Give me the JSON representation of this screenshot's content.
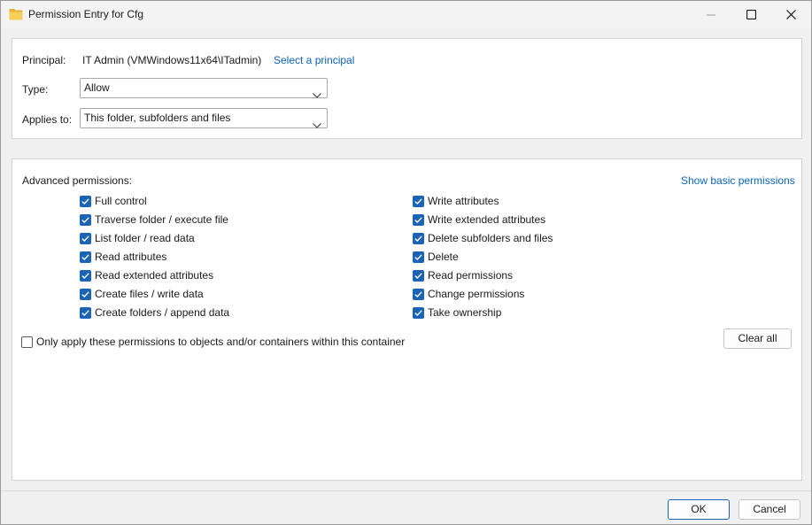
{
  "window": {
    "title": "Permission Entry for Cfg",
    "icons": {
      "app": "folder-icon",
      "minimize": "minimize-icon",
      "maximize": "maximize-icon",
      "close": "close-icon"
    }
  },
  "principal": {
    "label": "Principal:",
    "value": "IT Admin (VMWindows11x64\\ITadmin)",
    "link": "Select a principal"
  },
  "type": {
    "label": "Type:",
    "selected": "Allow"
  },
  "applies_to": {
    "label": "Applies to:",
    "selected": "This folder, subfolders and files"
  },
  "advanced": {
    "heading": "Advanced permissions:",
    "toggle_link": "Show basic permissions",
    "left_column": [
      {
        "label": "Full control",
        "checked": true
      },
      {
        "label": "Traverse folder / execute file",
        "checked": true
      },
      {
        "label": "List folder / read data",
        "checked": true
      },
      {
        "label": "Read attributes",
        "checked": true
      },
      {
        "label": "Read extended attributes",
        "checked": true
      },
      {
        "label": "Create files / write data",
        "checked": true
      },
      {
        "label": "Create folders / append data",
        "checked": true
      }
    ],
    "right_column": [
      {
        "label": "Write attributes",
        "checked": true
      },
      {
        "label": "Write extended attributes",
        "checked": true
      },
      {
        "label": "Delete subfolders and files",
        "checked": true
      },
      {
        "label": "Delete",
        "checked": true
      },
      {
        "label": "Read permissions",
        "checked": true
      },
      {
        "label": "Change permissions",
        "checked": true
      },
      {
        "label": "Take ownership",
        "checked": true
      }
    ],
    "only_apply": {
      "label": "Only apply these permissions to objects and/or containers within this container",
      "checked": false
    },
    "clear_all": "Clear all"
  },
  "footer": {
    "ok": "OK",
    "cancel": "Cancel"
  },
  "colors": {
    "accent": "#1a63b5",
    "link": "#0a63b8",
    "panel_bg": "#ffffff",
    "window_bg": "#f0f0f0"
  }
}
